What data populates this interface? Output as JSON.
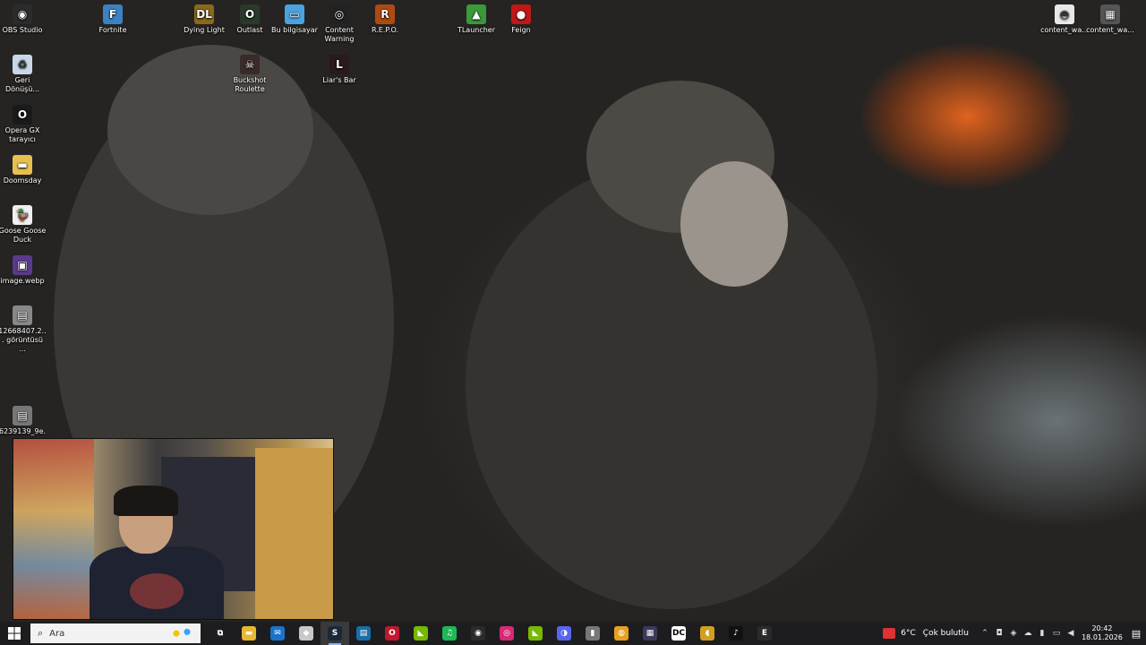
{
  "desktop": {
    "icons": [
      {
        "label": "OBS Studio",
        "icon": "obs-icon",
        "color": "#2b2b2b",
        "glyph": "◉"
      },
      {
        "label": "Fortnite",
        "icon": "fortnite-icon",
        "color": "#3b82c4",
        "glyph": "F"
      },
      {
        "label": "Dying Light",
        "icon": "dying-light-icon",
        "color": "#8a6a1a",
        "glyph": "DL"
      },
      {
        "label": "Outlast",
        "icon": "outlast-icon",
        "color": "#2a3a2a",
        "glyph": "O"
      },
      {
        "label": "Bu bilgisayar",
        "icon": "computer-icon",
        "color": "#4aa3e0",
        "glyph": "▭"
      },
      {
        "label": "Content Warning",
        "icon": "content-warning-icon",
        "color": "#222",
        "glyph": "◎"
      },
      {
        "label": "R.E.P.O.",
        "icon": "repo-icon",
        "color": "#b04a10",
        "glyph": "R"
      },
      {
        "label": "TLauncher",
        "icon": "tlauncher-icon",
        "color": "#3a9a3a",
        "glyph": "▲"
      },
      {
        "label": "Feign",
        "icon": "feign-icon",
        "color": "#c01818",
        "glyph": "●"
      },
      {
        "label": "content_wa...",
        "icon": "content-wa-icon-1",
        "color": "#e8e8e8",
        "glyph": "◓"
      },
      {
        "label": "content_wa...",
        "icon": "content-wa-icon-2",
        "color": "#555",
        "glyph": "▦"
      },
      {
        "label": "Buckshot Roulette",
        "icon": "buckshot-roulette-icon",
        "color": "#3a2a2a",
        "glyph": "☠"
      },
      {
        "label": "Liar's Bar",
        "icon": "liars-bar-icon",
        "color": "#2a1a1a",
        "glyph": "L"
      },
      {
        "label": "Geri Dönüşü...",
        "icon": "recycle-bin-icon",
        "color": "#c8d8e8",
        "glyph": "♻"
      },
      {
        "label": "Opera GX tarayıcı",
        "icon": "opera-gx-icon",
        "color": "#1a1a1a",
        "glyph": "O"
      },
      {
        "label": "Doomsday",
        "icon": "folder-icon",
        "color": "#e8c050",
        "glyph": "▬"
      },
      {
        "label": "Goose Goose Duck",
        "icon": "goose-goose-duck-icon",
        "color": "#f0f0f0",
        "glyph": "🦆"
      },
      {
        "label": "image.webp",
        "icon": "image-file-icon",
        "color": "#5a3a8a",
        "glyph": "▣"
      },
      {
        "label": "12668407.2... görüntüsü ...",
        "icon": "screenshot-file-icon",
        "color": "#888",
        "glyph": "▤"
      },
      {
        "label": "6239139_9e...",
        "icon": "image-file-icon-2",
        "color": "#777",
        "glyph": "▤"
      }
    ]
  },
  "taskbar": {
    "search_placeholder": "Ara",
    "apps": [
      {
        "name": "task-view-icon",
        "glyph": "⧉",
        "color": "#1d1d1f"
      },
      {
        "name": "file-explorer-icon",
        "glyph": "▬",
        "color": "#e8b830"
      },
      {
        "name": "mail-icon",
        "glyph": "✉",
        "color": "#1a73c8"
      },
      {
        "name": "fortnite-launcher-icon",
        "glyph": "◆",
        "color": "#c8c8c8"
      },
      {
        "name": "steam-icon",
        "glyph": "S",
        "color": "#1b2838"
      },
      {
        "name": "store-icon",
        "glyph": "▤",
        "color": "#1a6ea8"
      },
      {
        "name": "opera-gx-icon",
        "glyph": "O",
        "color": "#c01830"
      },
      {
        "name": "nvidia-icon",
        "glyph": "◣",
        "color": "#76b900"
      },
      {
        "name": "spotify-icon",
        "glyph": "♫",
        "color": "#1db954"
      },
      {
        "name": "obs-icon",
        "glyph": "◉",
        "color": "#2b2b2b"
      },
      {
        "name": "instagram-icon",
        "glyph": "◎",
        "color": "#d62976"
      },
      {
        "name": "nvidia-app-icon",
        "glyph": "◣",
        "color": "#76b900"
      },
      {
        "name": "discord-icon",
        "glyph": "◑",
        "color": "#5865f2"
      },
      {
        "name": "microphone-icon",
        "glyph": "▮",
        "color": "#777"
      },
      {
        "name": "chrome-icon",
        "glyph": "◍",
        "color": "#e8a020"
      },
      {
        "name": "keyboard-icon",
        "glyph": "▦",
        "color": "#3a3a5a"
      },
      {
        "name": "dc-icon",
        "glyph": "DC",
        "color": "#fff"
      },
      {
        "name": "audio-app-icon",
        "glyph": "◖",
        "color": "#d0a020"
      },
      {
        "name": "tiktok-icon",
        "glyph": "♪",
        "color": "#111"
      },
      {
        "name": "epic-games-icon",
        "glyph": "E",
        "color": "#2a2a2a"
      }
    ],
    "weather": {
      "temp": "6°C",
      "condition": "Çok bulutlu"
    },
    "clock": {
      "time": "20:42",
      "date": "18.01.2026"
    }
  }
}
